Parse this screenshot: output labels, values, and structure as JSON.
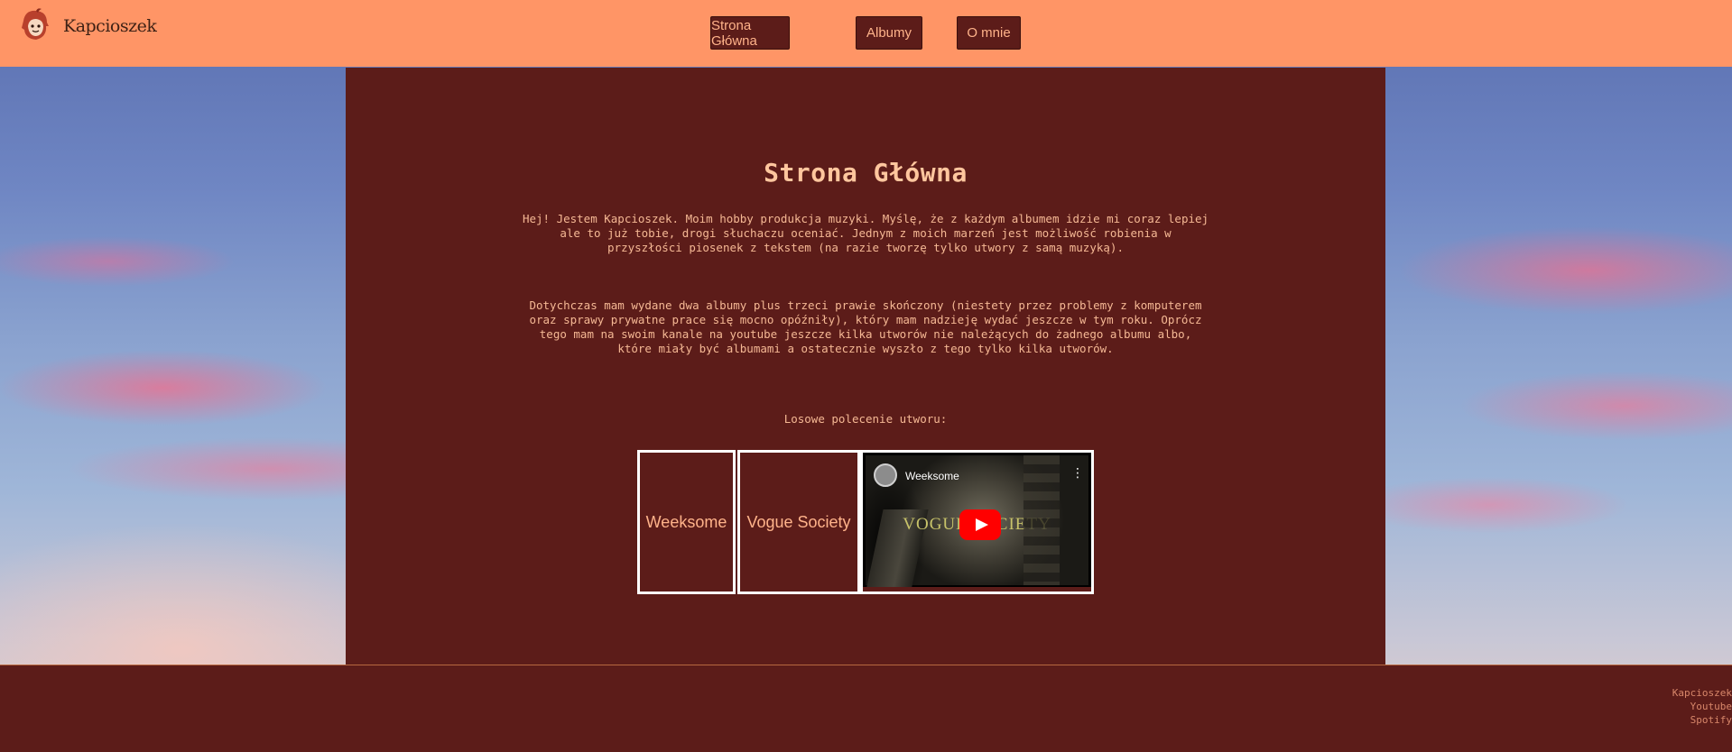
{
  "header": {
    "brand": "Kapcioszek",
    "nav": [
      {
        "label": "Strona Główna"
      },
      {
        "label": "Albumy"
      },
      {
        "label": "O mnie"
      }
    ]
  },
  "main": {
    "title": "Strona Główna",
    "paragraph_1": "Hej! Jestem Kapcioszek. Moim hobby produkcja muzyki. Myślę, że z każdym albumem idzie mi coraz lepiej\nale to już tobie, drogi słuchaczu oceniać. Jednym z moich marzeń jest możliwość robienia w\nprzyszłości piosenek z tekstem (na razie tworzę tylko utwory z samą muzyką).",
    "paragraph_2": "Dotychczas mam wydane dwa albumy plus trzeci prawie skończony (niestety przez problemy z komputerem\noraz sprawy prywatne prace się mocno opóźniły), który mam nadzieję wydać jeszcze w tym roku. Oprócz\ntego mam na swoim kanale na youtube jeszcze kilka utworów nie należących do żadnego albumu albo,\nktóre miały być albumami a ostatecznie wyszło z tego tylko kilka utworów.",
    "recommend_label": "Losowe polecenie utworu:",
    "recommendation": {
      "artist": "Weeksome",
      "album": "Vogue Society",
      "video": {
        "channel_title": "Weeksome",
        "menu_icon": "more-vert-icon",
        "overlay_text": "VOGUE SOCIETY",
        "play_icon": "youtube-play-icon"
      }
    }
  },
  "footer": {
    "links": [
      "Kapcioszek",
      "Youtube",
      "Spotify"
    ]
  },
  "colors": {
    "header_bg": "#ff9566",
    "main_bg": "#5c1c19",
    "accent_text": "#ffb38a"
  }
}
